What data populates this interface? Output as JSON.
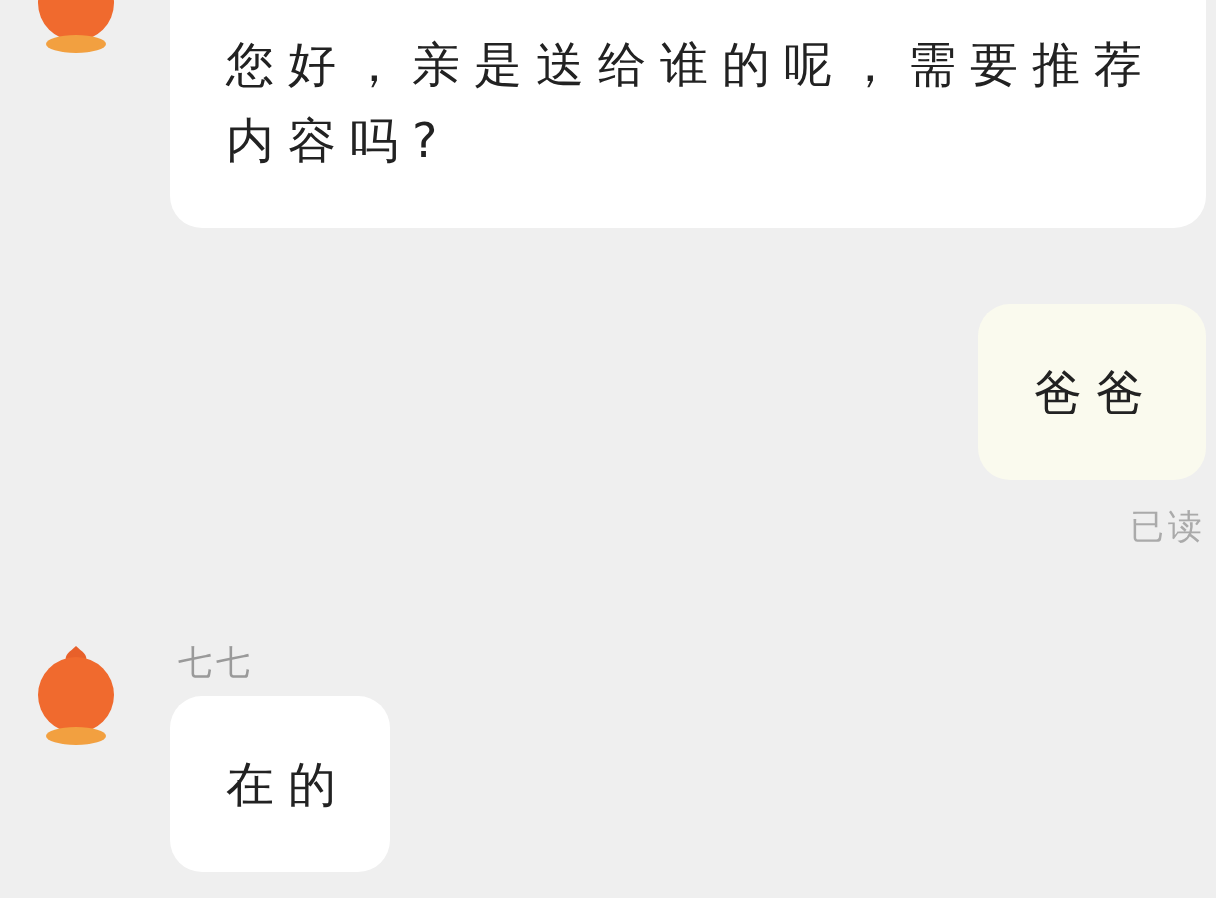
{
  "messages": [
    {
      "kind": "incoming",
      "text": "您好，亲是送给谁的呢，需要推荐内容吗?"
    },
    {
      "kind": "outgoing",
      "text": "爸爸",
      "status": "已读"
    },
    {
      "kind": "incoming",
      "sender": "七七",
      "text": "在的"
    }
  ]
}
